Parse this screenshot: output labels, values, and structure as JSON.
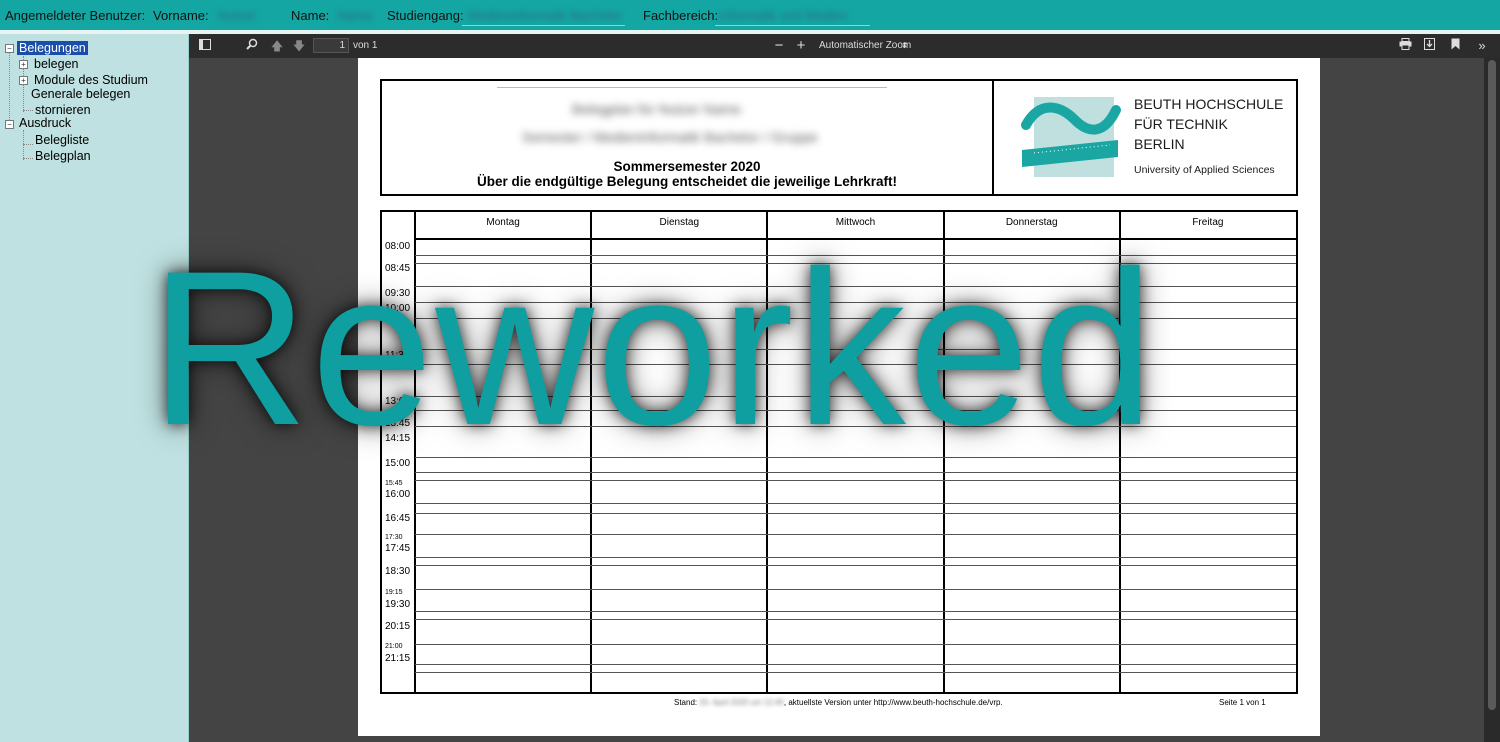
{
  "topbar": {
    "logged_in_label": "Angemeldeter Benutzer:",
    "vorname_label": "Vorname:",
    "vorname_value": "Nutzer",
    "name_label": "Name:",
    "name_value": "Name",
    "studiengang_label": "Studiengang:",
    "studiengang_value": "Medieninformatik Bachelor",
    "fachbereich_label": "Fachbereich:",
    "fachbereich_value": "Informatik und Medien"
  },
  "sidebar": {
    "belegungen": "Belegungen",
    "belegen": "belegen",
    "module": "Module des Studium",
    "generale": "Generale belegen",
    "stornieren": "stornieren",
    "ausdruck": "Ausdruck",
    "belegliste": "Belegliste",
    "belegplan": "Belegplan"
  },
  "pdf_toolbar": {
    "page_number": "1",
    "page_count": "von 1",
    "zoom": "Automatischer Zoom"
  },
  "document": {
    "blur_line_1": "Belegplan für Nutzer Name",
    "blur_line_2": "Semester / Medieninformatik Bachelor / Gruppe",
    "semester": "Sommersemester 2020",
    "notice": "Über die endgültige Belegung entscheidet die jeweilige Lehrkraft!",
    "logo_line1": "BEUTH HOCHSCHULE",
    "logo_line2": "FÜR TECHNIK",
    "logo_line3": "BERLIN",
    "logo_sub": "University of Applied Sciences",
    "days": [
      "Montag",
      "Dienstag",
      "Mittwoch",
      "Donnerstag",
      "Freitag"
    ],
    "times": [
      "08:00",
      "08:45",
      "09:30",
      "10:00",
      "11:30",
      "13:00",
      "13:45",
      "14:15",
      "15:00",
      "15:45",
      "16:00",
      "16:45",
      "17:30",
      "17:45",
      "18:30",
      "19:15",
      "19:30",
      "20:15",
      "21:00",
      "21:15"
    ],
    "footer_prefix": "Stand:",
    "footer_date": "20. April 2020 um 12:45",
    "footer_suffix": ", aktuellste Version unter http://www.beuth-hochschule.de/vrp.",
    "footer_page": "Seite  1 von 1"
  },
  "watermark": "Reworked",
  "colors": {
    "teal": "#14a6a3",
    "sidebar": "#bfe1e1",
    "watermark": "#0f9fa0"
  }
}
